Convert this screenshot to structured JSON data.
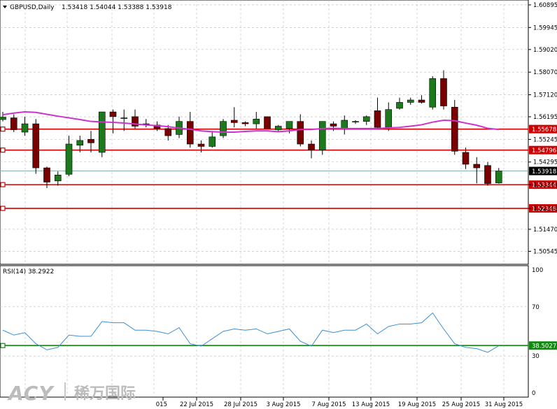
{
  "header": {
    "title": "GBPUSD,Daily",
    "ohlc": "1.53418 1.54044 1.53388 1.53918"
  },
  "rsi": {
    "label": "RSI(14) 38.2922",
    "level_label": "38.5027",
    "axis_ticks": [
      "100",
      "70",
      "30",
      "0"
    ]
  },
  "logo": {
    "text": "ACY",
    "cn_text": "稀万国际"
  },
  "price_ticks": [
    "1.60895",
    "1.59945",
    "1.59020",
    "1.58070",
    "1.57120",
    "1.56195",
    "1.55245",
    "1.54295",
    "1.53344",
    "1.52348",
    "1.51470",
    "1.50545"
  ],
  "hlines": [
    {
      "label": "1.55678",
      "value": 1.55678
    },
    {
      "label": "1.54796",
      "value": 1.54796
    },
    {
      "label": "1.53344",
      "value": 1.53344
    },
    {
      "label": "1.52348",
      "value": 1.52348
    }
  ],
  "current_price": {
    "label": "1.53918",
    "value": 1.53918
  },
  "date_ticks": [
    "015",
    "22 Jul 2015",
    "28 Jul 2015",
    "3 Aug 2015",
    "7 Aug 2015",
    "13 Aug 2015",
    "19 Aug 2015",
    "25 Aug 2015",
    "31 Aug 2015"
  ],
  "colors": {
    "bull": "#1c7a1c",
    "bear": "#7a0000",
    "ma": "#cc33cc",
    "rsi": "#3b8fd4",
    "hline": "#cc0000",
    "rsi_level": "#118811",
    "grid": "#b8b8b8"
  },
  "chart_data": {
    "type": "candlestick",
    "symbol": "GBPUSD",
    "timeframe": "Daily",
    "price_range": [
      1.5,
      1.611
    ],
    "candles": [
      {
        "o": 1.5608,
        "h": 1.564,
        "l": 1.56,
        "c": 1.5618
      },
      {
        "o": 1.5615,
        "h": 1.563,
        "l": 1.5555,
        "c": 1.5565
      },
      {
        "o": 1.5555,
        "h": 1.562,
        "l": 1.554,
        "c": 1.559
      },
      {
        "o": 1.559,
        "h": 1.561,
        "l": 1.538,
        "c": 1.5405
      },
      {
        "o": 1.5405,
        "h": 1.541,
        "l": 1.532,
        "c": 1.5345
      },
      {
        "o": 1.535,
        "h": 1.539,
        "l": 1.533,
        "c": 1.5375
      },
      {
        "o": 1.5378,
        "h": 1.554,
        "l": 1.537,
        "c": 1.5505
      },
      {
        "o": 1.55,
        "h": 1.554,
        "l": 1.547,
        "c": 1.552
      },
      {
        "o": 1.5525,
        "h": 1.556,
        "l": 1.547,
        "c": 1.551
      },
      {
        "o": 1.547,
        "h": 1.564,
        "l": 1.545,
        "c": 1.564
      },
      {
        "o": 1.564,
        "h": 1.565,
        "l": 1.555,
        "c": 1.562
      },
      {
        "o": 1.5615,
        "h": 1.565,
        "l": 1.556,
        "c": 1.5615
      },
      {
        "o": 1.562,
        "h": 1.565,
        "l": 1.557,
        "c": 1.558
      },
      {
        "o": 1.559,
        "h": 1.561,
        "l": 1.5575,
        "c": 1.5585
      },
      {
        "o": 1.5585,
        "h": 1.56,
        "l": 1.556,
        "c": 1.557
      },
      {
        "o": 1.557,
        "h": 1.5585,
        "l": 1.552,
        "c": 1.554
      },
      {
        "o": 1.5545,
        "h": 1.562,
        "l": 1.553,
        "c": 1.56
      },
      {
        "o": 1.56,
        "h": 1.564,
        "l": 1.549,
        "c": 1.5505
      },
      {
        "o": 1.5505,
        "h": 1.552,
        "l": 1.547,
        "c": 1.5495
      },
      {
        "o": 1.5495,
        "h": 1.556,
        "l": 1.549,
        "c": 1.5535
      },
      {
        "o": 1.554,
        "h": 1.561,
        "l": 1.553,
        "c": 1.56
      },
      {
        "o": 1.5605,
        "h": 1.566,
        "l": 1.5575,
        "c": 1.5595
      },
      {
        "o": 1.5595,
        "h": 1.56,
        "l": 1.558,
        "c": 1.559
      },
      {
        "o": 1.559,
        "h": 1.564,
        "l": 1.557,
        "c": 1.561
      },
      {
        "o": 1.562,
        "h": 1.562,
        "l": 1.557,
        "c": 1.557
      },
      {
        "o": 1.5565,
        "h": 1.5585,
        "l": 1.5555,
        "c": 1.558
      },
      {
        "o": 1.557,
        "h": 1.56,
        "l": 1.555,
        "c": 1.56
      },
      {
        "o": 1.56,
        "h": 1.563,
        "l": 1.5495,
        "c": 1.5505
      },
      {
        "o": 1.5505,
        "h": 1.552,
        "l": 1.5445,
        "c": 1.548
      },
      {
        "o": 1.548,
        "h": 1.56,
        "l": 1.546,
        "c": 1.56
      },
      {
        "o": 1.559,
        "h": 1.56,
        "l": 1.556,
        "c": 1.558
      },
      {
        "o": 1.557,
        "h": 1.5625,
        "l": 1.5545,
        "c": 1.5605
      },
      {
        "o": 1.56,
        "h": 1.5605,
        "l": 1.559,
        "c": 1.56
      },
      {
        "o": 1.56,
        "h": 1.5625,
        "l": 1.5585,
        "c": 1.562
      },
      {
        "o": 1.5645,
        "h": 1.57,
        "l": 1.557,
        "c": 1.5575
      },
      {
        "o": 1.5575,
        "h": 1.568,
        "l": 1.556,
        "c": 1.565
      },
      {
        "o": 1.5655,
        "h": 1.57,
        "l": 1.565,
        "c": 1.568
      },
      {
        "o": 1.568,
        "h": 1.57,
        "l": 1.567,
        "c": 1.569
      },
      {
        "o": 1.569,
        "h": 1.571,
        "l": 1.5675,
        "c": 1.568
      },
      {
        "o": 1.566,
        "h": 1.579,
        "l": 1.565,
        "c": 1.578
      },
      {
        "o": 1.578,
        "h": 1.5815,
        "l": 1.565,
        "c": 1.5665
      },
      {
        "o": 1.566,
        "h": 1.569,
        "l": 1.546,
        "c": 1.5475
      },
      {
        "o": 1.547,
        "h": 1.549,
        "l": 1.54,
        "c": 1.542
      },
      {
        "o": 1.542,
        "h": 1.545,
        "l": 1.534,
        "c": 1.5405
      },
      {
        "o": 1.5415,
        "h": 1.543,
        "l": 1.533,
        "c": 1.5339
      },
      {
        "o": 1.53418,
        "h": 1.54044,
        "l": 1.53388,
        "c": 1.53918
      }
    ],
    "ma": [
      1.5628,
      1.5635,
      1.564,
      1.5638,
      1.563,
      1.5622,
      1.5615,
      1.5608,
      1.56,
      1.5598,
      1.5596,
      1.5593,
      1.5589,
      1.5585,
      1.5582,
      1.5578,
      1.5572,
      1.5567,
      1.556,
      1.5557,
      1.5555,
      1.5555,
      1.5558,
      1.556,
      1.556,
      1.5557,
      1.556,
      1.5566,
      1.5566,
      1.557,
      1.5571,
      1.557,
      1.557,
      1.557,
      1.557,
      1.5573,
      1.5575,
      1.558,
      1.5586,
      1.5597,
      1.5605,
      1.5603,
      1.5593,
      1.5584,
      1.5571,
      1.5566
    ],
    "rsi_values": [
      51,
      47,
      49,
      40,
      35,
      37,
      47,
      46,
      46,
      58,
      57,
      57,
      51,
      51,
      50,
      48,
      53,
      40,
      38,
      44,
      50,
      52,
      51,
      52,
      48,
      50,
      52,
      42,
      38,
      51,
      49,
      51,
      51,
      56,
      48,
      54,
      56,
      56,
      57,
      65,
      52,
      40,
      37,
      36,
      33,
      38.29
    ],
    "rsi_range": [
      0,
      100
    ],
    "rsi_levels": [
      70,
      30,
      38.5027
    ]
  }
}
